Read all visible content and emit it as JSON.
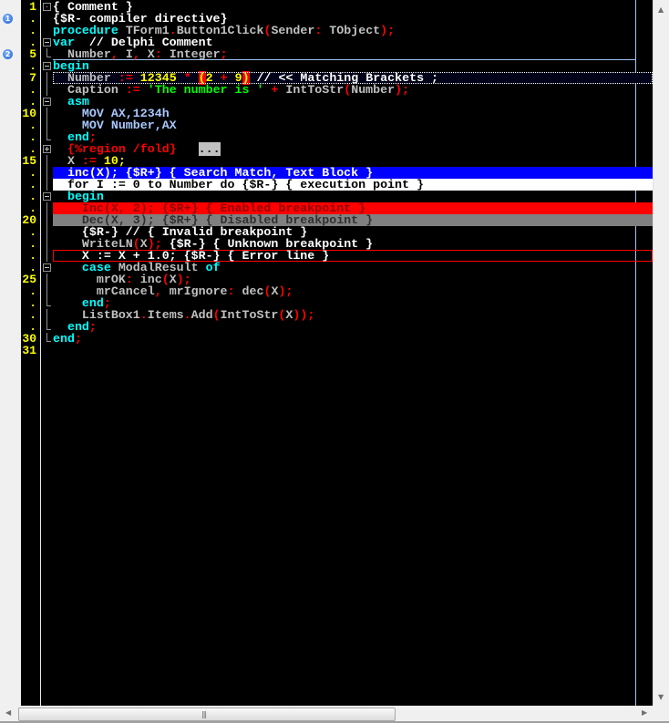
{
  "colors": {
    "background": "#000000",
    "keyword": "#00ffff",
    "identifier": "#c0c0c0",
    "symbol": "#ff0000",
    "number": "#ffff00",
    "comment": "#ffffff",
    "string": "#00ff00",
    "asm": "#a8c8ff",
    "search_match": "#0000ff",
    "execution_point": "#ffffff",
    "enabled_breakpoint": "#ff0000",
    "disabled_breakpoint": "#808080",
    "line_numbers": "#ffff00"
  },
  "bookmarks": [
    {
      "row": 2,
      "label": "1",
      "icon": "bookmark-1-icon"
    },
    {
      "row": 5,
      "label": "2",
      "icon": "bookmark-2-icon"
    }
  ],
  "line_numbers": [
    "1",
    ".",
    ".",
    ".",
    "5",
    ".",
    "7",
    ".",
    ".",
    "10",
    ".",
    ".",
    ".",
    "15",
    ".",
    ".",
    ".",
    ".",
    "20",
    ".",
    ".",
    ".",
    ".",
    "25",
    ".",
    ".",
    ".",
    ".",
    "30",
    "31"
  ],
  "folds": [
    "dot",
    "none",
    "none",
    "minus",
    "end",
    "minus",
    "line",
    "line",
    "minus",
    "line",
    "line",
    "end",
    "plus",
    "line",
    "line",
    "line",
    "minus",
    "line",
    "line",
    "line",
    "line",
    "line",
    "minus",
    "line",
    "line",
    "end",
    "line",
    "end",
    "end",
    "none"
  ],
  "lines": [
    {
      "tokens": [
        [
          "c",
          "{ Comment }"
        ]
      ]
    },
    {
      "tokens": [
        [
          "c",
          "{$R- compiler directive}"
        ]
      ]
    },
    {
      "tokens": [
        [
          "k",
          "procedure"
        ],
        [
          "c",
          " "
        ],
        [
          "i",
          "TForm1"
        ],
        [
          "s",
          "."
        ],
        [
          "i",
          "Button1Click"
        ],
        [
          "s",
          "("
        ],
        [
          "i",
          "Sender"
        ],
        [
          "s",
          ":"
        ],
        [
          "c",
          " "
        ],
        [
          "i",
          "TObject"
        ],
        [
          "s",
          ");"
        ]
      ]
    },
    {
      "tokens": [
        [
          "k",
          "var"
        ],
        [
          "c",
          "  // Delphi Comment"
        ]
      ]
    },
    {
      "tokens": [
        [
          "c",
          "  "
        ],
        [
          "i",
          "Number"
        ],
        [
          "s",
          ","
        ],
        [
          "c",
          " "
        ],
        [
          "i",
          "I"
        ],
        [
          "s",
          ","
        ],
        [
          "c",
          " "
        ],
        [
          "i",
          "X"
        ],
        [
          "s",
          ":"
        ],
        [
          "c",
          " "
        ],
        [
          "i",
          "Integer"
        ],
        [
          "s",
          ";"
        ]
      ]
    },
    {
      "tokens": [
        [
          "k",
          "begin"
        ]
      ]
    },
    {
      "hl": "current",
      "tokens": [
        [
          "c",
          "  "
        ],
        [
          "i",
          "Number"
        ],
        [
          "c",
          " "
        ],
        [
          "s",
          ":="
        ],
        [
          "c",
          " "
        ],
        [
          "n",
          "12345"
        ],
        [
          "c",
          " "
        ],
        [
          "s",
          "*"
        ],
        [
          "c",
          " "
        ],
        [
          "b",
          "("
        ],
        [
          "n",
          "2"
        ],
        [
          "c",
          " "
        ],
        [
          "s",
          "+"
        ],
        [
          "c",
          " "
        ],
        [
          "n",
          "9"
        ],
        [
          "b",
          ")"
        ],
        [
          "c",
          " // << Matching Brackets ;"
        ]
      ]
    },
    {
      "tokens": [
        [
          "c",
          "  "
        ],
        [
          "i",
          "Caption"
        ],
        [
          "c",
          " "
        ],
        [
          "s",
          ":="
        ],
        [
          "c",
          " "
        ],
        [
          "str",
          "'The number is '"
        ],
        [
          "c",
          " "
        ],
        [
          "s",
          "+"
        ],
        [
          "c",
          " "
        ],
        [
          "i",
          "IntToStr"
        ],
        [
          "s",
          "("
        ],
        [
          "i",
          "Number"
        ],
        [
          "s",
          ");"
        ]
      ]
    },
    {
      "tokens": [
        [
          "c",
          "  "
        ],
        [
          "k",
          "asm"
        ]
      ]
    },
    {
      "tokens": [
        [
          "c",
          "    "
        ],
        [
          "a",
          "MOV AX,1234h"
        ]
      ]
    },
    {
      "tokens": [
        [
          "c",
          "    "
        ],
        [
          "a",
          "MOV Number,AX"
        ]
      ]
    },
    {
      "tokens": [
        [
          "c",
          "  "
        ],
        [
          "k",
          "end"
        ],
        [
          "s",
          ";"
        ]
      ]
    },
    {
      "tokens": [
        [
          "c",
          "  "
        ],
        [
          "fd",
          "{%region /fold}"
        ],
        [
          "c",
          "   "
        ],
        [
          "foldbtn",
          "..."
        ]
      ]
    },
    {
      "tokens": [
        [
          "c",
          "  "
        ],
        [
          "i",
          "X"
        ],
        [
          "c",
          " "
        ],
        [
          "s",
          ":="
        ],
        [
          "c",
          " "
        ],
        [
          "n",
          "10;"
        ]
      ]
    },
    {
      "hl": "search",
      "tokens": [
        [
          "c",
          "  inc(X); {$R+} { Search Match, Text Block }"
        ]
      ]
    },
    {
      "hl": "exec",
      "tokens": [
        [
          "c",
          "  for I := 0 to Number do {$R-} { execution point }"
        ]
      ]
    },
    {
      "tokens": [
        [
          "c",
          "  "
        ],
        [
          "k",
          "begin"
        ]
      ]
    },
    {
      "hl": "bp",
      "tokens": [
        [
          "c",
          "    Inc(X, 2); {$R+} { Enabled breakpoint }"
        ]
      ]
    },
    {
      "hl": "bpoff",
      "tokens": [
        [
          "c",
          "    Dec(X, 3); {$R+} { Disabled breakpoint }"
        ]
      ]
    },
    {
      "tokens": [
        [
          "c",
          "    {$R-} // { Invalid breakpoint }"
        ]
      ]
    },
    {
      "tokens": [
        [
          "c",
          "    "
        ],
        [
          "i",
          "WriteLN"
        ],
        [
          "s",
          "("
        ],
        [
          "i",
          "X"
        ],
        [
          "s",
          ");"
        ],
        [
          "c",
          " {$R-} { Unknown breakpoint }"
        ]
      ]
    },
    {
      "hl": "err",
      "tokens": [
        [
          "c",
          "    X := X + 1.0; {$R-} { Error line }"
        ]
      ]
    },
    {
      "tokens": [
        [
          "c",
          "    "
        ],
        [
          "k",
          "case"
        ],
        [
          "c",
          " "
        ],
        [
          "i",
          "ModalResult"
        ],
        [
          "c",
          " "
        ],
        [
          "k",
          "of"
        ]
      ]
    },
    {
      "tokens": [
        [
          "c",
          "      "
        ],
        [
          "i",
          "mrOK"
        ],
        [
          "s",
          ":"
        ],
        [
          "c",
          " "
        ],
        [
          "i",
          "inc"
        ],
        [
          "s",
          "("
        ],
        [
          "i",
          "X"
        ],
        [
          "s",
          ");"
        ]
      ]
    },
    {
      "tokens": [
        [
          "c",
          "      "
        ],
        [
          "i",
          "mrCancel"
        ],
        [
          "s",
          ","
        ],
        [
          "c",
          " "
        ],
        [
          "i",
          "mrIgnore"
        ],
        [
          "s",
          ":"
        ],
        [
          "c",
          " "
        ],
        [
          "i",
          "dec"
        ],
        [
          "s",
          "("
        ],
        [
          "i",
          "X"
        ],
        [
          "s",
          ");"
        ]
      ]
    },
    {
      "tokens": [
        [
          "c",
          "    "
        ],
        [
          "k",
          "end"
        ],
        [
          "s",
          ";"
        ]
      ]
    },
    {
      "tokens": [
        [
          "c",
          "    "
        ],
        [
          "i",
          "ListBox1"
        ],
        [
          "s",
          "."
        ],
        [
          "i",
          "Items"
        ],
        [
          "s",
          "."
        ],
        [
          "i",
          "Add"
        ],
        [
          "s",
          "("
        ],
        [
          "i",
          "IntToStr"
        ],
        [
          "s",
          "("
        ],
        [
          "i",
          "X"
        ],
        [
          "s",
          "));"
        ]
      ]
    },
    {
      "tokens": [
        [
          "c",
          "  "
        ],
        [
          "k",
          "end"
        ],
        [
          "s",
          ";"
        ]
      ]
    },
    {
      "tokens": [
        [
          "k",
          "end"
        ],
        [
          "s",
          ";"
        ]
      ]
    },
    {
      "tokens": []
    }
  ],
  "scrollbars": {
    "horizontal_position": 0,
    "horizontal_thumb_fraction": 0.57,
    "vertical_position": 0
  }
}
